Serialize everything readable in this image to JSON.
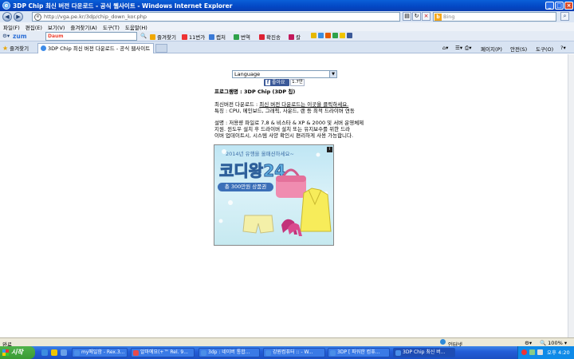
{
  "window": {
    "title": "3DP Chip 최신 버전 다운로드 - 공식 웹사이트 - Windows Internet Explorer"
  },
  "address": {
    "url": "http://vga.pe.kr/3dp/chip_down_kor.php",
    "search_placeholder": "Bing"
  },
  "menu": [
    "파일(F)",
    "편집(E)",
    "보기(V)",
    "즐겨찾기(A)",
    "도구(T)",
    "도움말(H)"
  ],
  "toolbar": {
    "zum": "zum",
    "search_logo": "Daum",
    "items": [
      "즐겨찾기",
      "11번가",
      "캡처",
      "번역",
      "확진송",
      "칼"
    ]
  },
  "tabs": {
    "favorites": "즐겨찾기",
    "active_tab": "3DP Chip 최신 버전 다운로드 - 공식 웹사이트",
    "commands": [
      "페이지(P)",
      "안전(S)",
      "도구(O)"
    ]
  },
  "content": {
    "language_select": "Language",
    "like_label": "좋아요",
    "like_count": "1.7만",
    "program_name": "프로그램명 : 3DP Chip (3DP 칩)",
    "latest_label": "최신버전 다운로드 :",
    "latest_link": "최신 버전 다운로드는 이곳을 클릭하세요.",
    "features": "특징 : CPU, 메인보드, 그래픽, 사운드, 랜 등 최적 드라이버 연동",
    "desc1": "설명 : 저용량 파일로 7,8 & 비스타 & XP & 2000 및 서버 운영체제",
    "desc2": "지원. 윈도우 설치 후 드라이버 설치 또는 유지보수를 위한 드라",
    "desc3": "이버 업데이트시, 시스템 사양 확인시 편리하게 사용 가능합니다.",
    "banner": {
      "top": "2014년 유행을 올패션하세요~",
      "title": "코디왕24",
      "prize": "총 300만원 상품권"
    }
  },
  "status": {
    "left": "완료",
    "zone": "인터넷",
    "zoom": "100%"
  },
  "taskbar": {
    "start": "시작",
    "tasks": [
      "my메일함 - Rex.3...",
      "알마에요(+™ Rel. 9...",
      "3dp : 네이버 통합...",
      "강원컴퓨터 :: - W...",
      "3DP [ 파워한 컴퓨...",
      "3DP Chip 최신 버..."
    ],
    "clock": "오후 4:20"
  },
  "colors": {
    "titlebar": "#0a5fd8",
    "taskbar": "#245ed8",
    "start": "#3a9b34",
    "facebook": "#3b5998"
  }
}
